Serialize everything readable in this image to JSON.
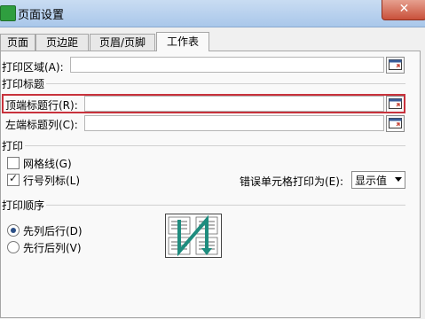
{
  "window": {
    "title": "页面设置"
  },
  "close_icon": "close-icon",
  "tabs": [
    {
      "label": "页面",
      "active": false
    },
    {
      "label": "页边距",
      "active": false
    },
    {
      "label": "页眉/页脚",
      "active": false
    },
    {
      "label": "工作表",
      "active": true
    }
  ],
  "print_area": {
    "label": "打印区域(A):",
    "value": ""
  },
  "print_titles": {
    "section": "打印标题",
    "top_rows": {
      "label": "顶端标题行(R):",
      "value": ""
    },
    "left_cols": {
      "label": "左端标题列(C):",
      "value": ""
    }
  },
  "print": {
    "section": "打印",
    "gridlines": {
      "label": "网格线(G)",
      "checked": false
    },
    "row_col_headers": {
      "label": "行号列标(L)",
      "checked": true
    },
    "errors": {
      "label": "错误单元格打印为(E):",
      "selected": "显示值"
    }
  },
  "page_order": {
    "section": "打印顺序",
    "down_then_over": {
      "label": "先列后行(D)",
      "selected": true
    },
    "over_then_down": {
      "label": "先行后列(V)",
      "selected": false
    }
  },
  "colors": {
    "highlight": "#c8323c",
    "order_arrow": "#1e8c7e"
  }
}
